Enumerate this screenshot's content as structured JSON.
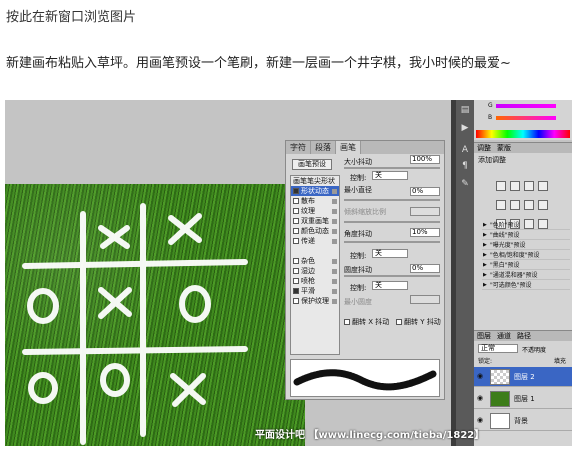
{
  "header": {
    "link_text": "按此在新窗口浏览图片"
  },
  "article": {
    "intro": "新建画布粘贴入草坪。用画笔预设一个笔刷，新建一层画一个井字棋，我小时候的最爱~"
  },
  "brush_panel": {
    "tabs": [
      "字符",
      "段落",
      "画笔"
    ],
    "active_tab": 2,
    "preset_button": "画笔预设",
    "tip_items": [
      {
        "label": "画笔笔尖形状",
        "checked": null,
        "selected": false
      },
      {
        "label": "形状动态",
        "checked": true,
        "selected": true
      },
      {
        "label": "散布",
        "checked": false,
        "selected": false
      },
      {
        "label": "纹理",
        "checked": false,
        "selected": false
      },
      {
        "label": "双重画笔",
        "checked": false,
        "selected": false
      },
      {
        "label": "颜色动态",
        "checked": false,
        "selected": false
      },
      {
        "label": "传递",
        "checked": false,
        "selected": false
      },
      {
        "label": "",
        "checked": null,
        "selected": false
      },
      {
        "label": "杂色",
        "checked": false,
        "selected": false
      },
      {
        "label": "湿边",
        "checked": false,
        "selected": false
      },
      {
        "label": "喷枪",
        "checked": false,
        "selected": false
      },
      {
        "label": "平滑",
        "checked": true,
        "selected": false
      },
      {
        "label": "保护纹理",
        "checked": false,
        "selected": false
      }
    ],
    "size_jitter_label": "大小抖动",
    "size_jitter_value": "100%",
    "control_label": "控制:",
    "control_off": "关",
    "min_diameter_label": "最小直径",
    "min_diameter_value": "0%",
    "tilt_scale_label": "倾斜缩放比例",
    "angle_jitter_label": "角度抖动",
    "angle_jitter_value": "10%",
    "roundness_jitter_label": "圆度抖动",
    "roundness_jitter_value": "0%",
    "min_roundness_label": "最小圆度",
    "flip_x_label": "翻转 X 抖动",
    "flip_y_label": "翻转 Y 抖动"
  },
  "color_panel": {
    "labels": [
      "G",
      "B"
    ]
  },
  "adjust_panel": {
    "tabs": [
      "调整",
      "蒙版"
    ],
    "title": "添加调整",
    "presets": [
      "\"色阶\"预设",
      "\"曲线\"预设",
      "\"曝光度\"预设",
      "\"色相/饱和度\"预设",
      "\"黑白\"预设",
      "\"通道混和器\"预设",
      "\"可选颜色\"预设"
    ]
  },
  "layers_panel": {
    "tabs": [
      "图层",
      "通道",
      "路径"
    ],
    "blend_mode": "正常",
    "opacity_label": "不透明度",
    "lock_label": "锁定:",
    "fill_label": "填充",
    "layers": [
      {
        "name": "图层 2",
        "selected": true,
        "thumb": "transparent"
      },
      {
        "name": "图层 1",
        "selected": false,
        "thumb": "grass"
      },
      {
        "name": "背景",
        "selected": false,
        "thumb": "white"
      }
    ]
  },
  "watermark": "平面设计吧 【www.linecg.com/tieba/1822】",
  "colors": {
    "selection": "#3a66c4",
    "grass": "#356f18",
    "panel": "#d4d4d4"
  }
}
